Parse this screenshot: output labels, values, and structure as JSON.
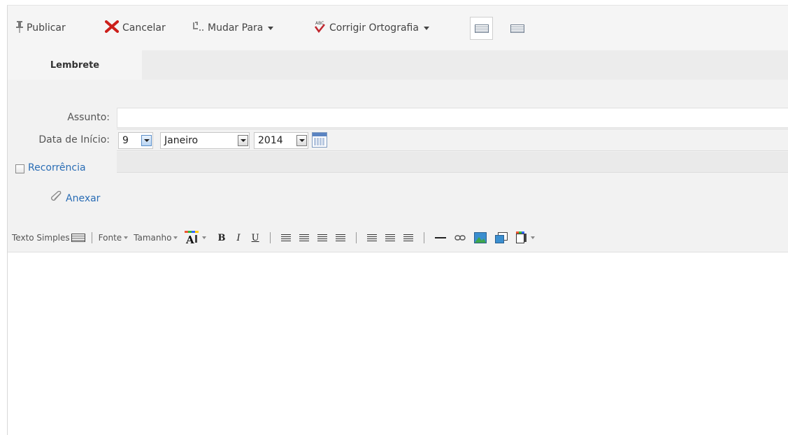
{
  "toolbar": {
    "publish_label": "Publicar",
    "cancel_label": "Cancelar",
    "move_label": "Mudar Para",
    "spell_label": "Corrigir Ortografia"
  },
  "tabs": [
    {
      "label": "Lembrete"
    }
  ],
  "form": {
    "subject_label": "Assunto:",
    "subject_value": "",
    "start_date_label": "Data de Início:",
    "day_value": "9",
    "month_value": "Janeiro",
    "year_value": "2014",
    "recurrence_label": "Recorrência",
    "recurrence_checked": false,
    "attach_label": "Anexar"
  },
  "editor_toolbar": {
    "plain_text_label": "Texto Simples",
    "font_label": "Fonte",
    "size_label": "Tamanho",
    "bold": "B",
    "italic": "I",
    "underline": "U"
  },
  "colors": {
    "link": "#2a6db5",
    "cancel_icon": "#cc1f1a",
    "background": "#f2f2f2"
  }
}
